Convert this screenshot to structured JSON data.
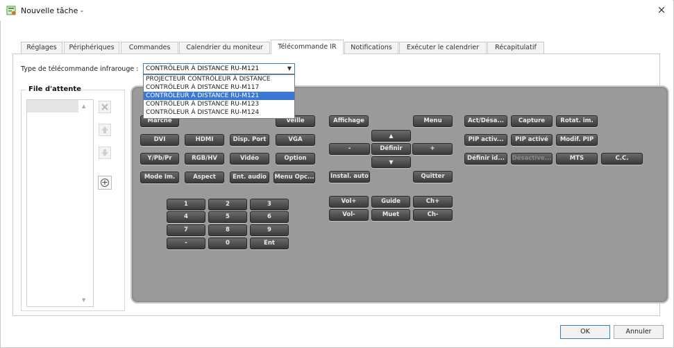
{
  "window": {
    "title": "Nouvelle tâche -",
    "close_glyph": "×",
    "app_icon": "task-app-icon",
    "accent": "#3b78d4"
  },
  "tabs": [
    {
      "label": "Réglages",
      "active": false
    },
    {
      "label": "Périphériques",
      "active": false
    },
    {
      "label": "Commandes",
      "active": false
    },
    {
      "label": "Calendrier du moniteur",
      "active": false
    },
    {
      "label": "Télécommande IR",
      "active": true
    },
    {
      "label": "Notifications",
      "active": false
    },
    {
      "label": "Exécuter le calendrier",
      "active": false
    },
    {
      "label": "Récapitulatif",
      "active": false
    }
  ],
  "remote_type": {
    "label": "Type de télécommande infrarouge :",
    "selected": "CONTRÔLEUR À DISTANCE RU-M121",
    "options": [
      "PROJECTEUR CONTRÔLEUR À DISTANCE",
      "CONTRÔLEUR À DISTANCE RU-M117",
      "CONTRÔLEUR À DISTANCE RU-M121",
      "CONTRÔLEUR À DISTANCE RU-M123",
      "CONTRÔLEUR À DISTANCE RU-M124"
    ],
    "selected_index": 2
  },
  "queue": {
    "title": "File d'attente",
    "icons": [
      "delete-icon",
      "move-up-icon",
      "move-down-icon",
      "add-icon"
    ],
    "add_glyph": "+"
  },
  "remote": {
    "group1": [
      "Marche",
      "Veille",
      "DVI",
      "HDMI",
      "Disp. Port",
      "VGA",
      "Y/Pb/Pr",
      "RGB/HV",
      "Vidéo",
      "Option",
      "Mode Im.",
      "Aspect",
      "Ent. audio",
      "Menu Opc..."
    ],
    "keypad": [
      "1",
      "2",
      "3",
      "4",
      "5",
      "6",
      "7",
      "8",
      "9",
      "-",
      "0",
      "Ent"
    ],
    "nav": [
      "Affichage",
      "Menu",
      "▲",
      "-",
      "Définir",
      "+",
      "▼",
      "Instal. auto",
      "Quitter"
    ],
    "volume": [
      "Vol+",
      "Guide",
      "Ch+",
      "Vol-",
      "Muet",
      "Ch-"
    ],
    "group3": [
      "Act/Désa...",
      "Capture",
      "Rotat. im.",
      "PIP activ...",
      "PIP activé",
      "Modif. PIP",
      "Définir id...",
      "Désactive...",
      "MTS",
      "C.C."
    ]
  },
  "footer": {
    "ok": "OK",
    "cancel": "Annuler"
  }
}
